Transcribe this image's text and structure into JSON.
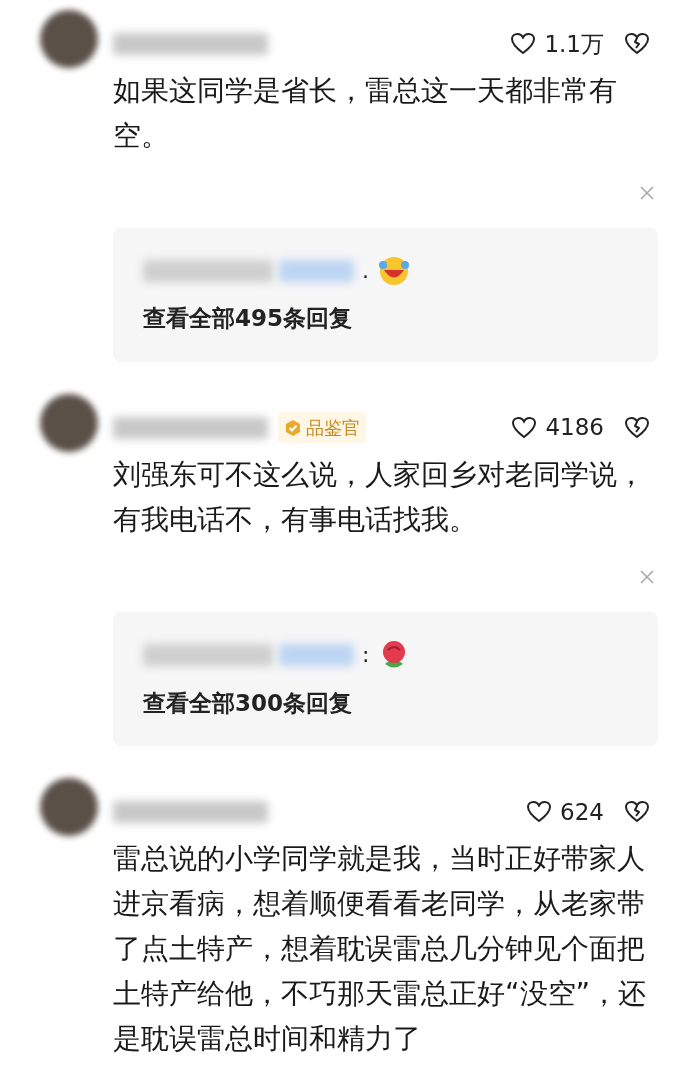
{
  "comments": [
    {
      "likes": "1.1万",
      "text": "如果这同学是省长，雷总这一天都非常有空。",
      "reply": {
        "separator": ".",
        "kind": "laughing",
        "link": "查看全部495条回复"
      }
    },
    {
      "likes": "4186",
      "badge": "品鉴官",
      "text": "刘强东可不这么说，人家回乡对老同学说，有我电话不，有事电话找我。",
      "reply": {
        "separator": ":",
        "kind": "rose",
        "link": "查看全部300条回复"
      }
    },
    {
      "likes": "624",
      "text": "雷总说的小学同学就是我，当时正好带家人进京看病，想着顺便看看老同学，从老家带了点土特产，想着耽误雷总几分钟见个面把土特产给他，不巧那天雷总正好“没空”，还是耽误雷总时间和精力了"
    }
  ]
}
